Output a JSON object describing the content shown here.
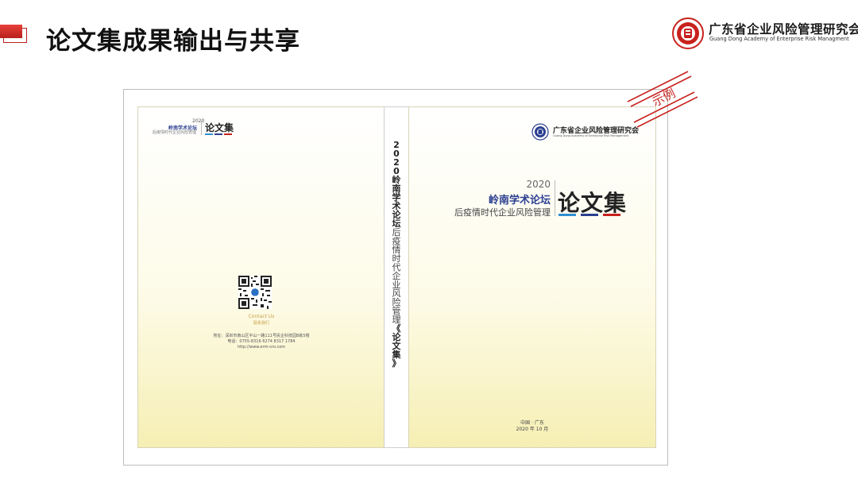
{
  "header": {
    "title": "论文集成果输出与共享",
    "org_name_cn": "广东省企业风险管理研究会",
    "org_name_en": "Guang Dong Academy of Enterprise Risk Managment"
  },
  "back_cover": {
    "year": "2020",
    "forum": "岭南学术论坛",
    "subtitle": "后疫情时代企业风险管理",
    "collection": "论文集",
    "contact_en": "Contact Us",
    "contact_cn": "联系我们",
    "address": "地址：深圳市南山区平山一路111号民企科技园B栋5楼",
    "phone": "电话：0755-8316 6274   8317 1784",
    "website": "http://www.erm-cro.com"
  },
  "spine": {
    "year_chars": [
      "2",
      "0",
      "2",
      "0"
    ],
    "forum_chars": [
      "岭",
      "南",
      "学",
      "术",
      "论",
      "坛"
    ],
    "subtitle_chars": [
      "后",
      "疫",
      "情",
      "时",
      "代",
      "企",
      "业",
      "风",
      "险",
      "管",
      "理"
    ],
    "collection_chars": [
      "《",
      "论",
      "文",
      "集",
      "》"
    ]
  },
  "front_cover": {
    "org_name_cn": "广东省企业风险管理研究会",
    "org_name_en": "Guang Dong Academy of Enterprise Risk Management",
    "year": "2020",
    "forum": "岭南学术论坛",
    "subtitle": "后疫情时代企业风险管理",
    "collection": "论文集",
    "place": "中国 · 广东",
    "date": "2020 年 10 月"
  },
  "stamp": {
    "text": "示例"
  },
  "colors": {
    "accent_red": "#c8221d",
    "navy": "#2b3f91",
    "bar_blue": "#2f8fd1",
    "bar_red": "#c8221d"
  }
}
